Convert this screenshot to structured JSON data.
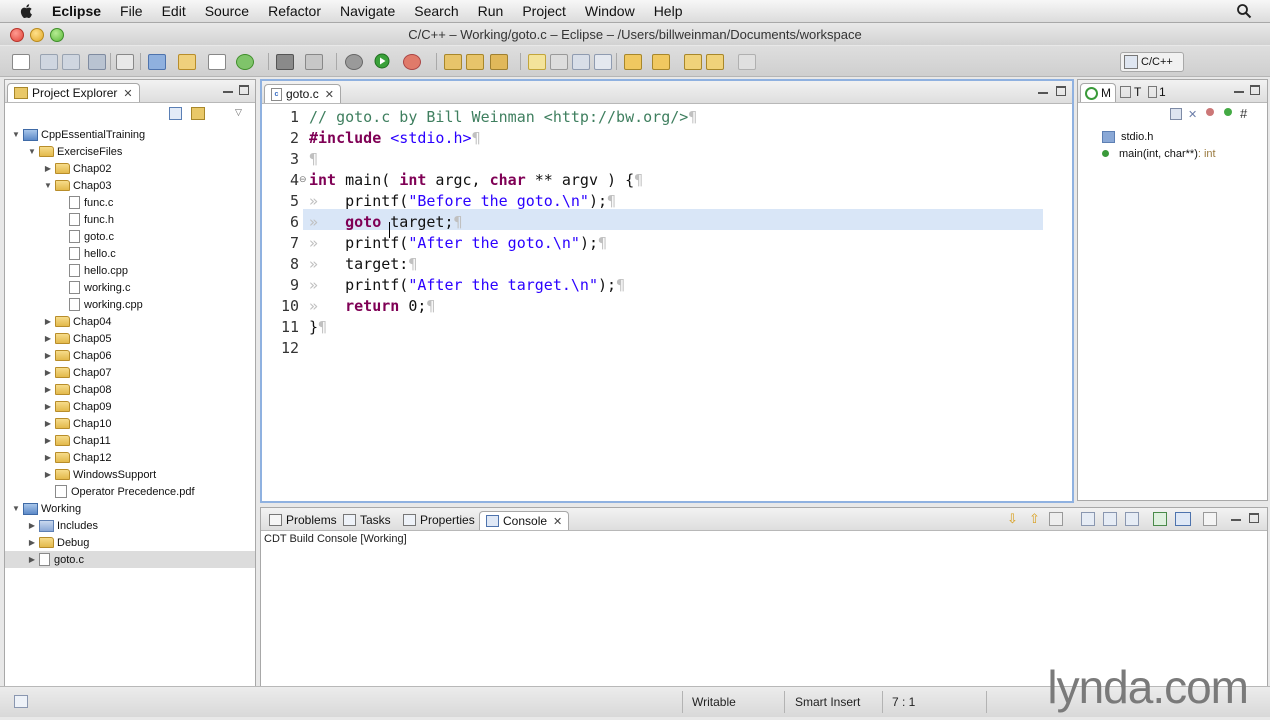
{
  "menubar": {
    "app_name": "Eclipse",
    "items": [
      "File",
      "Edit",
      "Source",
      "Refactor",
      "Navigate",
      "Search",
      "Run",
      "Project",
      "Window",
      "Help"
    ]
  },
  "window": {
    "title": "C/C++ – Working/goto.c – Eclipse – /Users/billweinman/Documents/workspace"
  },
  "toolbar": {
    "perspective_label": "C/C++"
  },
  "project_explorer": {
    "tab_label": "Project Explorer",
    "tree": [
      {
        "label": "CppEssentialTraining",
        "type": "project",
        "level": 0,
        "expanded": true
      },
      {
        "label": "ExerciseFiles",
        "type": "folder",
        "level": 1,
        "expanded": true
      },
      {
        "label": "Chap02",
        "type": "folder",
        "level": 2,
        "expanded": false
      },
      {
        "label": "Chap03",
        "type": "folder",
        "level": 2,
        "expanded": true
      },
      {
        "label": "func.c",
        "type": "cfile",
        "level": 3
      },
      {
        "label": "func.h",
        "type": "hfile",
        "level": 3
      },
      {
        "label": "goto.c",
        "type": "cfile",
        "level": 3
      },
      {
        "label": "hello.c",
        "type": "cfile",
        "level": 3
      },
      {
        "label": "hello.cpp",
        "type": "cfile",
        "level": 3
      },
      {
        "label": "working.c",
        "type": "cfile",
        "level": 3
      },
      {
        "label": "working.cpp",
        "type": "cfile",
        "level": 3
      },
      {
        "label": "Chap04",
        "type": "folder",
        "level": 2,
        "expanded": false
      },
      {
        "label": "Chap05",
        "type": "folder",
        "level": 2,
        "expanded": false
      },
      {
        "label": "Chap06",
        "type": "folder",
        "level": 2,
        "expanded": false
      },
      {
        "label": "Chap07",
        "type": "folder",
        "level": 2,
        "expanded": false
      },
      {
        "label": "Chap08",
        "type": "folder",
        "level": 2,
        "expanded": false
      },
      {
        "label": "Chap09",
        "type": "folder",
        "level": 2,
        "expanded": false
      },
      {
        "label": "Chap10",
        "type": "folder",
        "level": 2,
        "expanded": false
      },
      {
        "label": "Chap11",
        "type": "folder",
        "level": 2,
        "expanded": false
      },
      {
        "label": "Chap12",
        "type": "folder",
        "level": 2,
        "expanded": false
      },
      {
        "label": "WindowsSupport",
        "type": "folder",
        "level": 2,
        "expanded": false
      },
      {
        "label": "Operator Precedence.pdf",
        "type": "pdf",
        "level": 2
      },
      {
        "label": "Working",
        "type": "project",
        "level": 0,
        "expanded": true
      },
      {
        "label": "Includes",
        "type": "includes",
        "level": 1,
        "expanded": false
      },
      {
        "label": "Debug",
        "type": "folder",
        "level": 1,
        "expanded": false
      },
      {
        "label": "goto.c",
        "type": "cfile",
        "level": 1,
        "expanded": false,
        "selected": true
      }
    ]
  },
  "editor": {
    "tab_label": "goto.c",
    "current_line": 6,
    "lines": [
      {
        "n": "1",
        "fold": "",
        "indent": 0,
        "tokens": [
          {
            "t": "// goto.c by Bill Weinman <http://bw.org/>",
            "c": "cmt"
          }
        ]
      },
      {
        "n": "2",
        "fold": "",
        "indent": 0,
        "tokens": [
          {
            "t": "#include",
            "c": "kw"
          },
          {
            "t": " ",
            "c": ""
          },
          {
            "t": "<stdio.h>",
            "c": "str"
          }
        ]
      },
      {
        "n": "3",
        "fold": "",
        "indent": 0,
        "tokens": []
      },
      {
        "n": "4",
        "fold": "⊖",
        "indent": 0,
        "tokens": [
          {
            "t": "int",
            "c": "kw"
          },
          {
            "t": " main( ",
            "c": ""
          },
          {
            "t": "int",
            "c": "kw"
          },
          {
            "t": " argc, ",
            "c": ""
          },
          {
            "t": "char",
            "c": "kw"
          },
          {
            "t": " ** argv ) {",
            "c": ""
          }
        ]
      },
      {
        "n": "5",
        "fold": "",
        "indent": 1,
        "tokens": [
          {
            "t": "printf(",
            "c": ""
          },
          {
            "t": "\"Before the goto.\\n\"",
            "c": "str"
          },
          {
            "t": ");",
            "c": ""
          }
        ]
      },
      {
        "n": "6",
        "fold": "",
        "indent": 1,
        "tokens": [
          {
            "t": "goto",
            "c": "kw"
          },
          {
            "t": " target;",
            "c": ""
          }
        ]
      },
      {
        "n": "7",
        "fold": "",
        "indent": 1,
        "tokens": [
          {
            "t": "printf(",
            "c": ""
          },
          {
            "t": "\"After the goto.\\n\"",
            "c": "str"
          },
          {
            "t": ");",
            "c": ""
          }
        ]
      },
      {
        "n": "8",
        "fold": "",
        "indent": 1,
        "tokens": [
          {
            "t": "target:",
            "c": ""
          }
        ]
      },
      {
        "n": "9",
        "fold": "",
        "indent": 1,
        "tokens": [
          {
            "t": "printf(",
            "c": ""
          },
          {
            "t": "\"After the target.\\n\"",
            "c": "str"
          },
          {
            "t": ");",
            "c": ""
          }
        ]
      },
      {
        "n": "10",
        "fold": "",
        "indent": 1,
        "tokens": [
          {
            "t": "return",
            "c": "kw"
          },
          {
            "t": " 0;",
            "c": ""
          }
        ]
      },
      {
        "n": "11",
        "fold": "",
        "indent": 0,
        "tokens": [
          {
            "t": "}",
            "c": ""
          }
        ]
      },
      {
        "n": "12",
        "fold": "",
        "indent": 0,
        "tokens": [],
        "no_pilcrow": true
      }
    ]
  },
  "outline": {
    "tabs": [
      "M",
      "T",
      "1"
    ],
    "items": [
      {
        "label": "stdio.h",
        "type": "include"
      },
      {
        "label": "main(int, char**)",
        "suffix": " : int",
        "type": "function"
      }
    ]
  },
  "bottom_panel": {
    "tabs": [
      "Problems",
      "Tasks",
      "Properties",
      "Console"
    ],
    "active_tab": "Console",
    "console_title": "CDT Build Console [Working]"
  },
  "statusbar": {
    "writable": "Writable",
    "insert_mode": "Smart Insert",
    "position": "7 : 1"
  },
  "watermark": "lynda.com",
  "colors": {
    "keyword": "#7f0055",
    "string": "#2a00ff",
    "comment": "#3f7f5f",
    "current_line": "#d9e6f7",
    "selection": "#cfe0f7"
  }
}
